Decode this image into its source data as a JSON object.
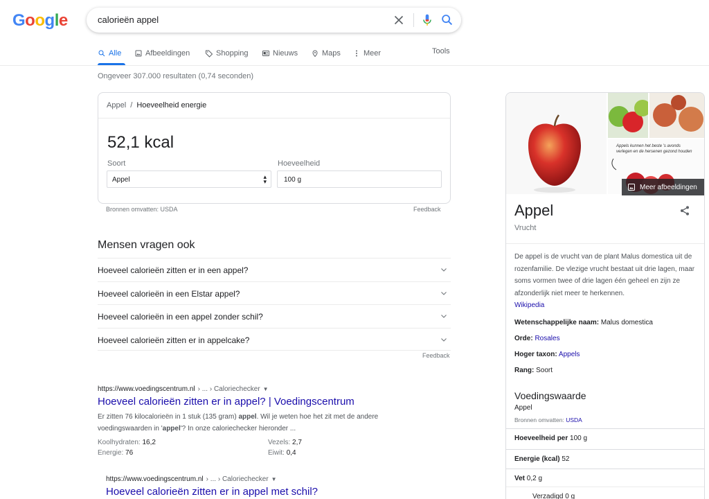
{
  "logo": {
    "letters": [
      "G",
      "o",
      "o",
      "g",
      "l",
      "e"
    ],
    "colors": [
      "#4285f4",
      "#ea4335",
      "#fbbc05",
      "#4285f4",
      "#34a853",
      "#ea4335"
    ]
  },
  "search": {
    "query": "calorieën appel"
  },
  "tabs": [
    {
      "label": "Alle",
      "icon": "search-icon"
    },
    {
      "label": "Afbeeldingen",
      "icon": "image-icon"
    },
    {
      "label": "Shopping",
      "icon": "tag-icon"
    },
    {
      "label": "Nieuws",
      "icon": "news-icon"
    },
    {
      "label": "Maps",
      "icon": "map-pin-icon"
    },
    {
      "label": "Meer",
      "icon": "more-vert-icon"
    }
  ],
  "tools_label": "Tools",
  "result_stats": "Ongeveer 307.000 resultaten (0,74 seconden)",
  "calorie_card": {
    "crumb_parent": "Appel",
    "crumb_sep": "/",
    "crumb_current": "Hoeveelheid energie",
    "value": "52,1 kcal",
    "soort_label": "Soort",
    "soort_value": "Appel",
    "hoeveelheid_label": "Hoeveelheid",
    "hoeveelheid_value": "100 g",
    "source": "Bronnen omvatten: USDA",
    "feedback": "Feedback"
  },
  "paa": {
    "title": "Mensen vragen ook",
    "questions": [
      "Hoeveel calorieën zitten er in een appel?",
      "Hoeveel calorieën in een Elstar appel?",
      "Hoeveel calorieën in een appel zonder schil?",
      "Hoeveel calorieën zitten er in appelcake?"
    ],
    "feedback": "Feedback"
  },
  "results": [
    {
      "url_domain": "https://www.voedingscentrum.nl",
      "url_path": "› ... › Caloriechecker",
      "title": "Hoeveel calorieën zitten er in appel? | Voedingscentrum",
      "snippet_1": "Er zitten 76 kilocalorieën in 1 stuk (135 gram) ",
      "snippet_bold_1": "appel",
      "snippet_2": ". Wil je weten hoe het zit met de andere voedingswaarden in '",
      "snippet_bold_2": "appel",
      "snippet_3": "'? In onze caloriechecker hieronder ...",
      "facts": [
        {
          "label": "Koolhydraten:",
          "value": "16,2"
        },
        {
          "label": "Vezels:",
          "value": "2,7"
        },
        {
          "label": "Energie:",
          "value": "76"
        },
        {
          "label": "Eiwit:",
          "value": "0,4"
        }
      ]
    },
    {
      "url_domain": "https://www.voedingscentrum.nl",
      "url_path": "› ... › Caloriechecker",
      "title": "Hoeveel calorieën zitten er in appel met schil?"
    }
  ],
  "knowledge_panel": {
    "more_images": "Meer afbeeldingen",
    "image_caption_line1": "Appels kunnen het beste 's avonds",
    "image_caption_line2": "verlegen en de hersenen gezond houden",
    "title": "Appel",
    "subtitle": "Vrucht",
    "description": "De appel is de vrucht van de plant Malus domestica uit de rozenfamilie. De vlezige vrucht bestaat uit drie lagen, maar soms vormen twee of drie lagen één geheel en zijn ze afzonderlijk niet meer te herkennen.",
    "wiki_link": "Wikipedia",
    "facts": [
      {
        "label": "Wetenschappelijke naam:",
        "value": "Malus domestica",
        "link": false
      },
      {
        "label": "Orde:",
        "value": "Rosales",
        "link": true
      },
      {
        "label": "Hoger taxon:",
        "value": "Appels",
        "link": true
      },
      {
        "label": "Rang:",
        "value": "Soort",
        "link": false
      }
    ],
    "nutrition": {
      "title": "Voedingswaarde",
      "item": "Appel",
      "source_prefix": "Bronnen omvatten: ",
      "source_link": "USDA",
      "rows": [
        {
          "label": "Hoeveelheid per",
          "value": "100 g"
        },
        {
          "label": "Energie (kcal)",
          "value": "52"
        },
        {
          "label": "Vet",
          "value": "0,2 g"
        },
        {
          "label": "Verzadigd",
          "value": "0 g"
        }
      ]
    }
  }
}
